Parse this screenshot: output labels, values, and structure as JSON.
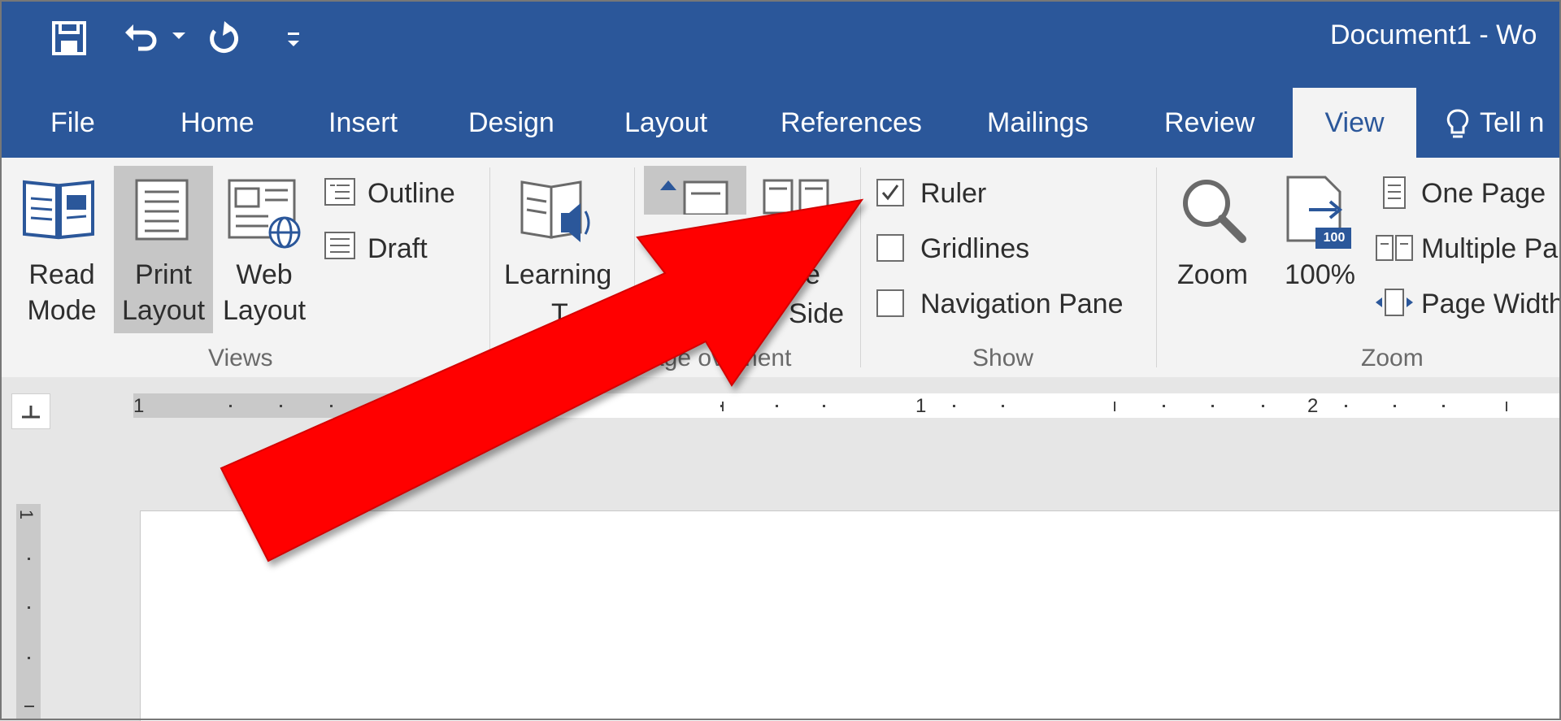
{
  "window": {
    "title": "Document1  -  Wo"
  },
  "quick_access": {
    "save_icon": "save-icon",
    "undo_icon": "undo-icon",
    "redo_icon": "redo-icon",
    "customize_icon": "customize-icon"
  },
  "tabs": [
    {
      "label": "File"
    },
    {
      "label": "Home"
    },
    {
      "label": "Insert"
    },
    {
      "label": "Design"
    },
    {
      "label": "Layout"
    },
    {
      "label": "References"
    },
    {
      "label": "Mailings"
    },
    {
      "label": "Review"
    },
    {
      "label": "View",
      "active": true
    },
    {
      "label": "Tell n"
    }
  ],
  "ribbon": {
    "views": {
      "read_mode": [
        "Read",
        "Mode"
      ],
      "print_layout": [
        "Print",
        "Layout"
      ],
      "web_layout": [
        "Web",
        "Layout"
      ],
      "outline": "Outline",
      "draft": "Draft",
      "label": "Views"
    },
    "immersive": {
      "learning_tools": "Learning",
      "learning_tools_2": "T"
    },
    "page_movement": {
      "side": "e",
      "side_2": "Side",
      "label": "age  ovement"
    },
    "show": {
      "ruler": "Ruler",
      "gridlines": "Gridlines",
      "navigation_pane": "Navigation Pane",
      "label": "Show",
      "ruler_checked": true,
      "gridlines_checked": false,
      "navigation_pane_checked": false
    },
    "zoom": {
      "zoom": "Zoom",
      "hundred": "100%",
      "one_page": "One Page",
      "multiple_pages": "Multiple Pa",
      "page_width": "Page Width",
      "label": "Zoom",
      "hundred_badge": "100"
    }
  },
  "ruler": {
    "numbers": [
      "1",
      "1",
      "2"
    ],
    "vertical_number": "1"
  },
  "colors": {
    "accent": "#2b579a",
    "arrow": "#ff0000",
    "ribbon": "#f3f3f3"
  }
}
